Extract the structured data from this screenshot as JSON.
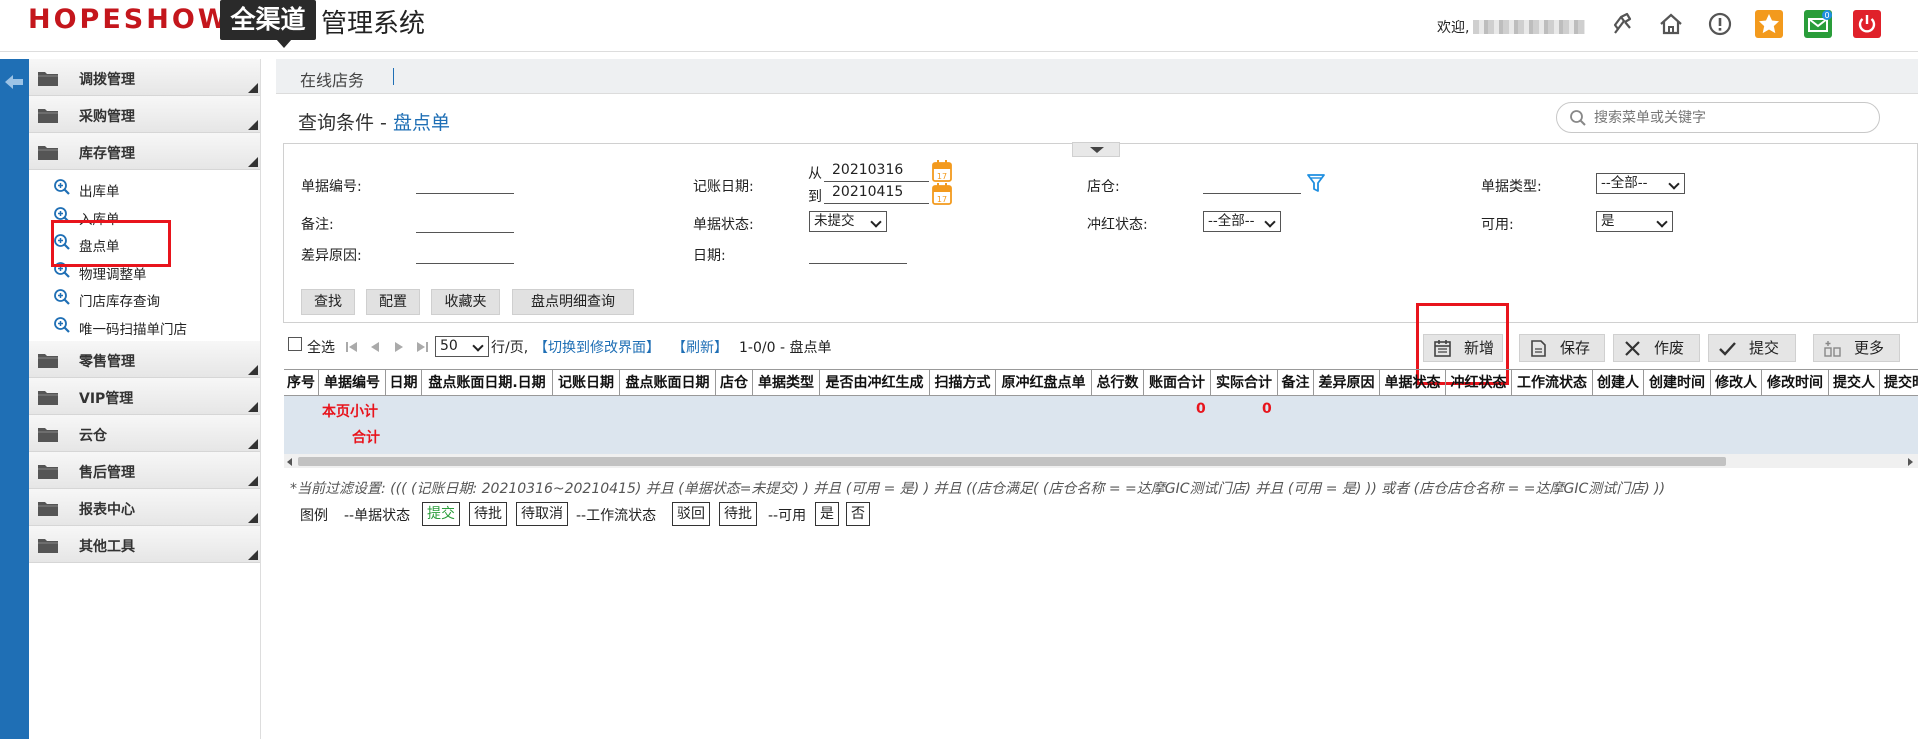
{
  "header": {
    "brand": "HOPESHOW",
    "logo_text": "全渠道",
    "system_name": "管理系统",
    "welcome": "欢迎,",
    "mail_badge": "0"
  },
  "tabs": {
    "online": "在线店务"
  },
  "sidebar": {
    "sections": [
      {
        "label": "调拨管理"
      },
      {
        "label": "采购管理"
      },
      {
        "label": "库存管理"
      }
    ],
    "sub_items": [
      "出库单",
      "入库单",
      "盘点单",
      "物理调整单",
      "门店库存查询",
      "唯一码扫描单门店"
    ],
    "sections_after": [
      {
        "label": "零售管理"
      },
      {
        "label": "VIP管理"
      },
      {
        "label": "云仓"
      },
      {
        "label": "售后管理"
      },
      {
        "label": "报表中心"
      },
      {
        "label": "其他工具"
      }
    ]
  },
  "query": {
    "title_prefix": "查询条件 - ",
    "title_name": "盘点单",
    "search_placeholder": "搜索菜单或关键字"
  },
  "filters": {
    "doc_no": "单据编号:",
    "remark": "备注:",
    "diff_reason": "差异原因:",
    "post_date": "记账日期:",
    "from": "从",
    "to": "到",
    "date_from": "20210316",
    "date_to": "20210415",
    "doc_status": "单据状态:",
    "doc_status_value": "未提交",
    "date": "日期:",
    "store": "店仓:",
    "reverse_status": "冲红状态:",
    "reverse_status_value": "--全部--",
    "doc_type": "单据类型:",
    "doc_type_value": "--全部--",
    "available": "可用:",
    "available_value": "是"
  },
  "filter_buttons": [
    "查找",
    "配置",
    "收藏夹",
    "盘点明细查询"
  ],
  "toolbar": {
    "select_all": "全选",
    "per_page": "50",
    "per_page_suffix": "行/页,",
    "switch_link": "【切换到修改界面】",
    "refresh_link": "【刷新】",
    "page_info": "1-0/0  - 盘点单",
    "add": "新增",
    "save": "保存",
    "void": "作废",
    "submit": "提交",
    "more": "更多"
  },
  "table": {
    "columns": [
      "序号",
      "单据编号",
      "日期",
      "盘点账面日期.日期",
      "记账日期",
      "盘点账面日期",
      "店仓",
      "单据类型",
      "是否由冲红生成",
      "扫描方式",
      "原冲红盘点单",
      "总行数",
      "账面合计",
      "实际合计",
      "备注",
      "差异原因",
      "单据状态",
      "冲红状态",
      "工作流状态",
      "创建人",
      "创建时间",
      "修改人",
      "修改时间",
      "提交人",
      "提交时间"
    ],
    "page_subtotal_label": "本页小计",
    "total_label": "合计",
    "book_total": "0",
    "actual_total": "0"
  },
  "filter_summary": "*当前过滤设置: ((( (记账日期: 20210316~20210415) 并且 (单据状态=未提交) ) 并且 (可用 = 是) ) 并且 ((店仓满足( (店仓名称 = =达摩GIC测试门店) 并且 (可用 = 是) )) 或者 (店仓店仓名称 = =达摩GIC测试门店) ))",
  "legend": {
    "title": "图例",
    "doc_status_label": "--单据状态",
    "doc_status_items": [
      "提交",
      "待批",
      "待取消"
    ],
    "workflow_label": "--工作流状态",
    "workflow_items": [
      "驳回",
      "待批"
    ],
    "available_label": "--可用",
    "available_items": [
      "是",
      "否"
    ]
  },
  "colors": {
    "accent_blue": "#1f6fb5",
    "highlight_red": "#e8141c",
    "brand_red": "#c4161c",
    "submit_green": "#2a9d3a"
  }
}
